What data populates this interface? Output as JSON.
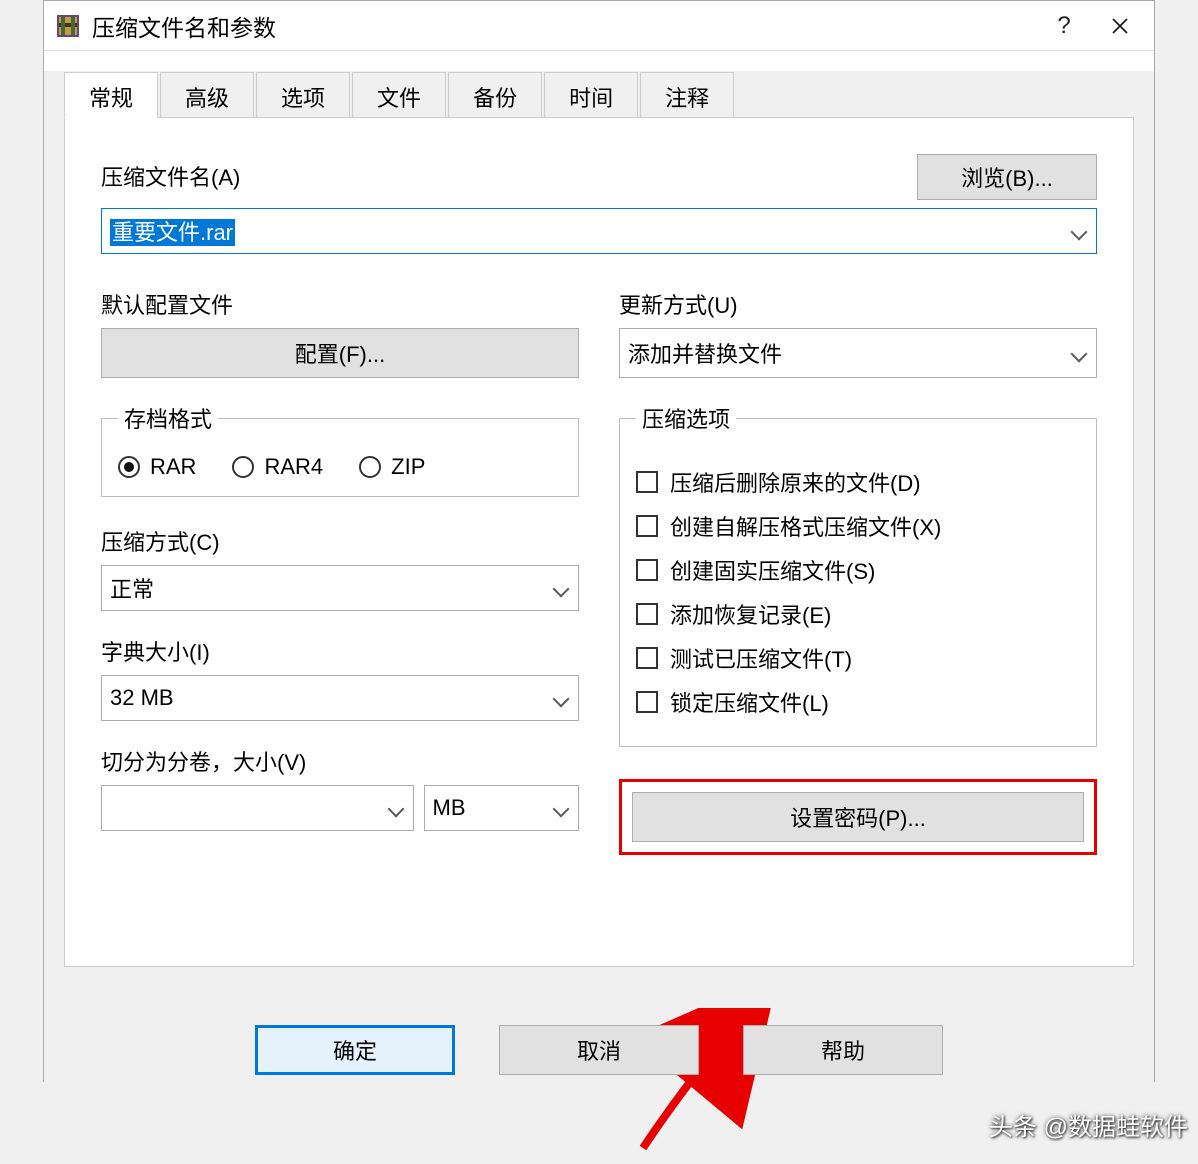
{
  "window": {
    "title": "压缩文件名和参数"
  },
  "tabs": {
    "items": [
      {
        "label": "常规"
      },
      {
        "label": "高级"
      },
      {
        "label": "选项"
      },
      {
        "label": "文件"
      },
      {
        "label": "备份"
      },
      {
        "label": "时间"
      },
      {
        "label": "注释"
      }
    ],
    "active_index": 0
  },
  "filename_section": {
    "label": "压缩文件名(A)",
    "value": "重要文件.rar",
    "browse_label": "浏览(B)..."
  },
  "left": {
    "profile_label": "默认配置文件",
    "profile_button": "配置(F)...",
    "archive_format_title": "存档格式",
    "archive_formats": [
      "RAR",
      "RAR4",
      "ZIP"
    ],
    "selected_format_index": 0,
    "compression_label": "压缩方式(C)",
    "compression_value": "正常",
    "dict_label": "字典大小(I)",
    "dict_value": "32 MB",
    "split_label": "切分为分卷，大小(V)",
    "split_value": "",
    "split_unit": "MB"
  },
  "right": {
    "update_label": "更新方式(U)",
    "update_value": "添加并替换文件",
    "options_title": "压缩选项",
    "options": [
      {
        "label": "压缩后删除原来的文件(D)",
        "checked": false
      },
      {
        "label": "创建自解压格式压缩文件(X)",
        "checked": false
      },
      {
        "label": "创建固实压缩文件(S)",
        "checked": false
      },
      {
        "label": "添加恢复记录(E)",
        "checked": false
      },
      {
        "label": "测试已压缩文件(T)",
        "checked": false
      },
      {
        "label": "锁定压缩文件(L)",
        "checked": false
      }
    ],
    "password_button": "设置密码(P)..."
  },
  "footer": {
    "ok": "确定",
    "cancel": "取消",
    "help": "帮助"
  },
  "watermark": "头条 @数据蛙软件"
}
